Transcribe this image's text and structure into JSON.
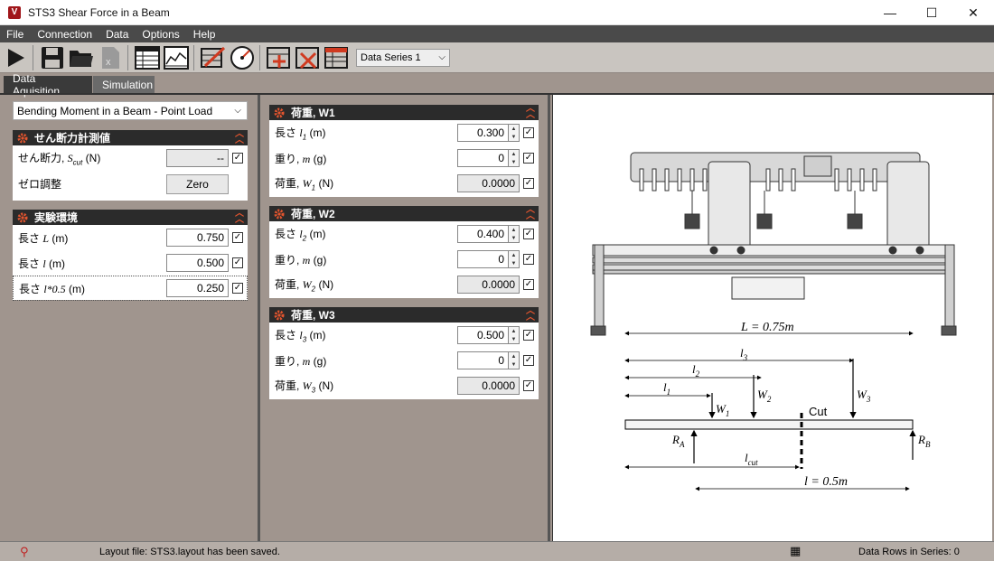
{
  "window": {
    "title": "STS3 Shear Force in a Beam",
    "app_icon": "V",
    "minimize": "—",
    "maximize": "☐",
    "close": "✕"
  },
  "menu": {
    "file": "File",
    "connection": "Connection",
    "data": "Data",
    "options": "Options",
    "help": "Help"
  },
  "toolbar": {
    "series_value": "Data Series 1"
  },
  "tabs": {
    "data_acq": "Data Aquisition",
    "simulation": "Simulation"
  },
  "left": {
    "combo_value": "Bending Moment in a Beam - Point Load",
    "measure": {
      "title": "せん断力計測値",
      "shear_label": "せん断力, ",
      "shear_symbol": "S",
      "shear_sub": "cut",
      "shear_unit": " (N)",
      "shear_value": "--",
      "zero_label": "ゼロ調整",
      "zero_button": "Zero"
    },
    "env": {
      "title": "実験環境",
      "rows": [
        {
          "prefix": "長さ ",
          "sym": "L",
          "unit": " (m)",
          "value": "0.750"
        },
        {
          "prefix": "長さ ",
          "sym": "l",
          "unit": " (m)",
          "value": "0.500"
        },
        {
          "prefix": "長さ ",
          "sym": "l*0.5",
          "unit": " (m)",
          "value": "0.250"
        }
      ]
    }
  },
  "loads": [
    {
      "title": "荷重, W1",
      "len_prefix": "長さ ",
      "len_sym": "l",
      "len_sub": "1",
      "len_unit": " (m)",
      "len_value": "0.300",
      "mass_prefix": "重り, ",
      "mass_sym": "m",
      "mass_unit": " (g)",
      "mass_value": "0",
      "w_prefix": "荷重, ",
      "w_sym": "W",
      "w_sub": "1",
      "w_unit": " (N)",
      "w_value": "0.0000"
    },
    {
      "title": "荷重, W2",
      "len_prefix": "長さ ",
      "len_sym": "l",
      "len_sub": "2",
      "len_unit": " (m)",
      "len_value": "0.400",
      "mass_prefix": "重り, ",
      "mass_sym": "m",
      "mass_unit": " (g)",
      "mass_value": "0",
      "w_prefix": "荷重, ",
      "w_sym": "W",
      "w_sub": "2",
      "w_unit": " (N)",
      "w_value": "0.0000"
    },
    {
      "title": "荷重, W3",
      "len_prefix": "長さ ",
      "len_sym": "l",
      "len_sub": "3",
      "len_unit": " (m)",
      "len_value": "0.500",
      "mass_prefix": "重り, ",
      "mass_sym": "m",
      "mass_unit": " (g)",
      "mass_value": "0",
      "w_prefix": "荷重, ",
      "w_sym": "W",
      "w_sub": "3",
      "w_unit": " (N)",
      "w_value": "0.0000"
    }
  ],
  "diagram": {
    "L_label": "L = 0.75m",
    "l_label": "l = 0.5m",
    "cut_label": "Cut",
    "l1": "l",
    "l1_sub": "1",
    "l2": "l",
    "l2_sub": "2",
    "l3": "l",
    "l3_sub": "3",
    "lcut": "l",
    "lcut_sub": "cut",
    "W1": "W",
    "W1_sub": "1",
    "W2": "W",
    "W2_sub": "2",
    "W3": "W",
    "W3_sub": "3",
    "RA": "R",
    "RA_sub": "A",
    "RB": "R",
    "RB_sub": "B"
  },
  "status": {
    "message": "Layout file: STS3.layout has been saved.",
    "rows": "Data Rows in Series: 0"
  },
  "colors": {
    "accent": "#e4552e",
    "header": "#2b2b2b",
    "panel_bg": "#a0958e"
  }
}
